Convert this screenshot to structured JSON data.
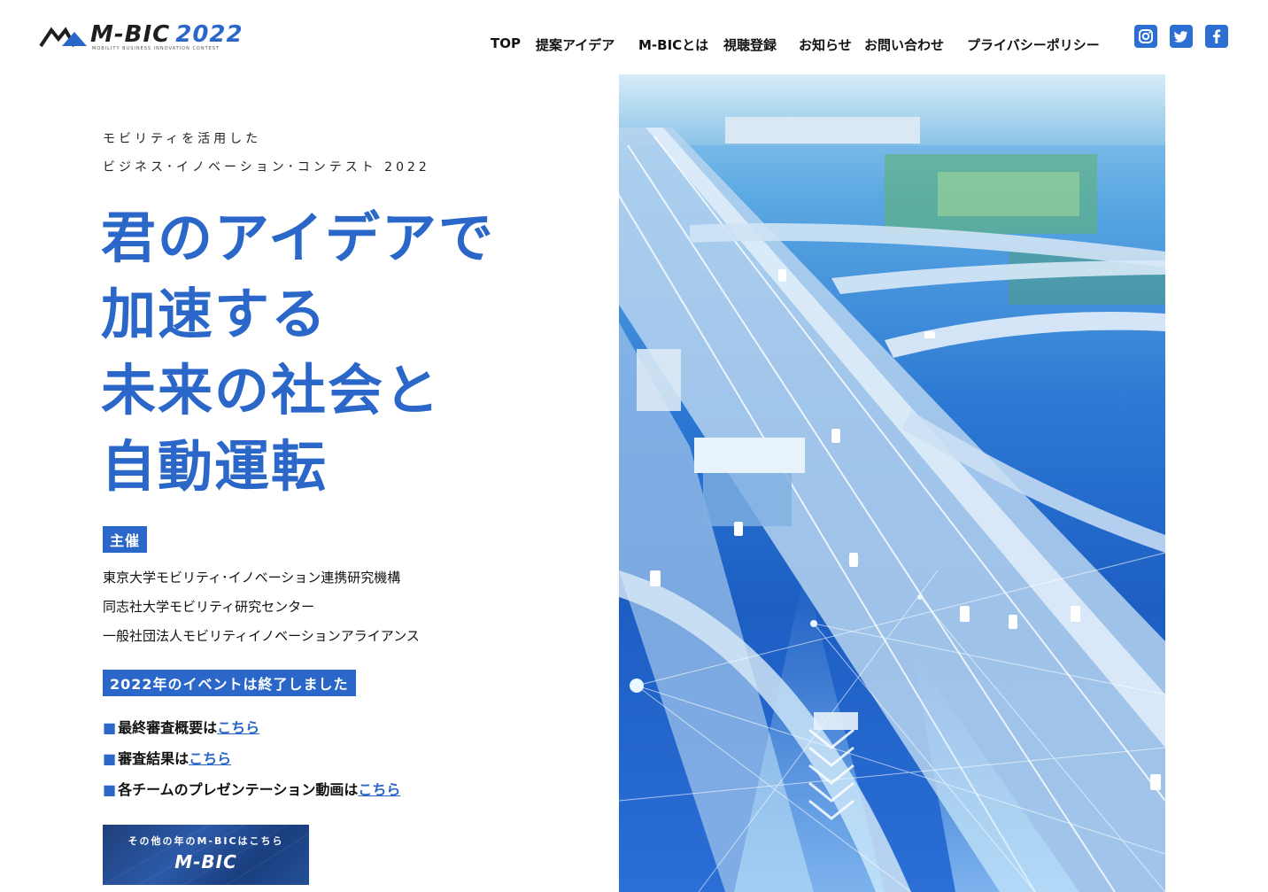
{
  "header": {
    "logo_text": "M-BIC",
    "logo_year": "2022",
    "logo_tagline": "MOBILITY BUSINESS INNOVATION CONTEST",
    "nav": [
      "TOP",
      "提案アイデア",
      "M-BICとは",
      "視聴登録",
      "お知らせ",
      "お問い合わせ",
      "プライバシーポリシー"
    ],
    "social": [
      "instagram-icon",
      "twitter-icon",
      "facebook-icon"
    ]
  },
  "hero": {
    "subtitle_1": "モビリティを活用した",
    "subtitle_2": "ビジネス･イノベーション･コンテスト 2022",
    "headline": [
      "君のアイデアで",
      "加速する",
      "未来の社会と",
      "自動運転"
    ]
  },
  "organizer": {
    "label": "主催",
    "orgs": [
      "東京大学モビリティ･イノベーション連携研究機構",
      "同志社大学モビリティ研究センター",
      "一般社団法人モビリティイノベーションアライアンス"
    ]
  },
  "event": {
    "ended_label": "2022年のイベントは終了しました",
    "bullet": "■",
    "items": [
      {
        "text": "最終審査概要は",
        "link": "こちら"
      },
      {
        "text": "審査結果は",
        "link": "こちら"
      },
      {
        "text": "各チームのプレゼンテーション動画は",
        "link": "こちら"
      }
    ]
  },
  "banner": {
    "caption": "その他の年のM-BICはこちら",
    "logo_text": "M-BIC"
  },
  "colors": {
    "accent": "#2a67c9",
    "social": "#2a6fd1"
  }
}
